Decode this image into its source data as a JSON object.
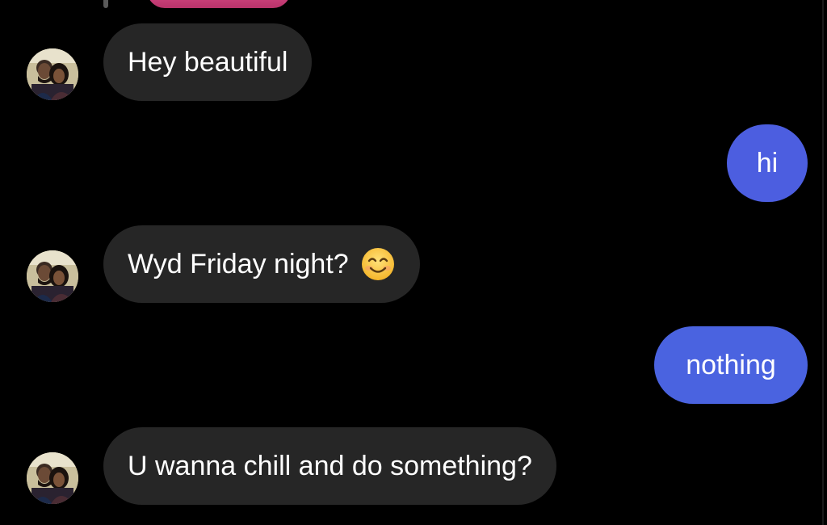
{
  "theme": {
    "background": "#000000",
    "incoming_bubble": "#262626",
    "outgoing_bubble_1": "#4c5ee0",
    "outgoing_bubble_2": "#4a63e0",
    "text": "#ffffff"
  },
  "messages": [
    {
      "direction": "incoming",
      "text": "Hey beautiful",
      "avatar": "contact-avatar"
    },
    {
      "direction": "outgoing",
      "text": "hi"
    },
    {
      "direction": "incoming",
      "text": "Wyd Friday night?",
      "emoji": "smiling-face-with-smiling-eyes-emoji",
      "avatar": "contact-avatar"
    },
    {
      "direction": "outgoing",
      "text": "nothing"
    },
    {
      "direction": "incoming",
      "text": "U wanna chill and do something?",
      "avatar": "contact-avatar"
    }
  ]
}
